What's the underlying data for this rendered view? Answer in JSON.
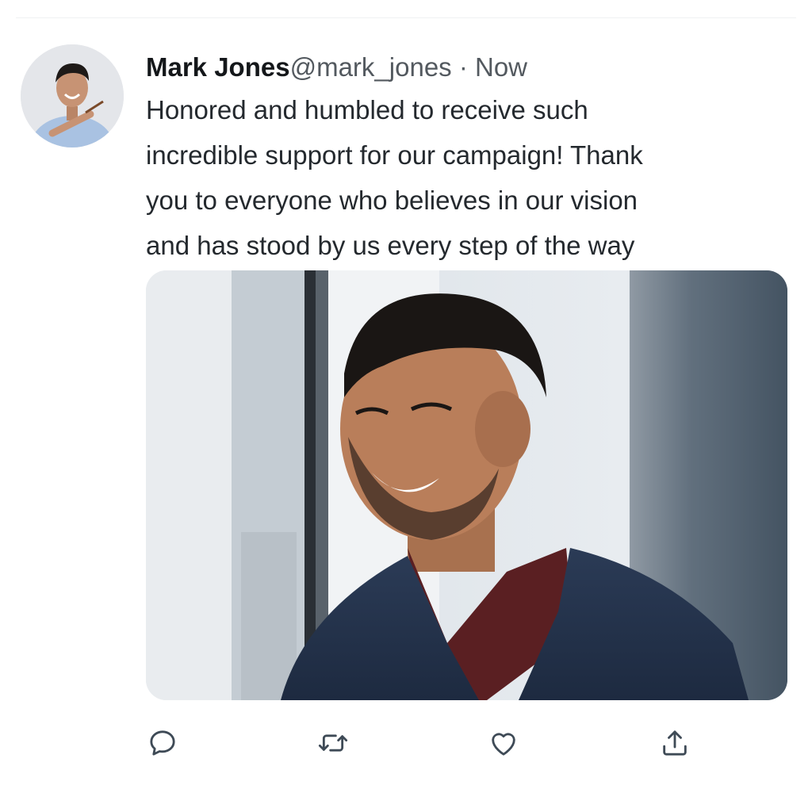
{
  "tweet": {
    "author_name": "Mark Jones",
    "handle": "@mark_jones",
    "separator": " · ",
    "timestamp": "Now",
    "text_lines": [
      "Honored and humbled to receive such",
      "incredible support for our campaign! Thank",
      "you to everyone who believes in our vision",
      "and has stood by us every step of the way"
    ]
  },
  "media": {
    "description_icon": "photo"
  },
  "actions": [
    {
      "name": "reply",
      "icon": "comment-icon"
    },
    {
      "name": "retweet",
      "icon": "retweet-icon"
    },
    {
      "name": "like",
      "icon": "heart-icon"
    },
    {
      "name": "share",
      "icon": "share-icon"
    }
  ],
  "colors": {
    "text": "#14171a",
    "secondary": "#53595f",
    "icon": "#3e4a56"
  }
}
